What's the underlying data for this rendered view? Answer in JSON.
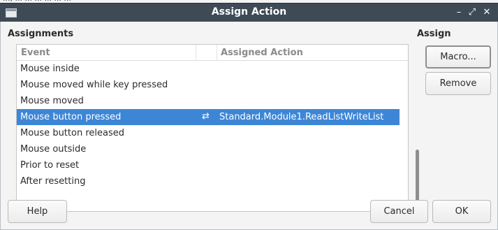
{
  "background_text": "..., ... ... ... ... ... ...",
  "window": {
    "title": "Assign Action",
    "min_label": "–",
    "max_label": "⤢",
    "close_label": "✕"
  },
  "assignments_label": "Assignments",
  "assign_label": "Assign",
  "columns": {
    "event": "Event",
    "assigned_action": "Assigned Action"
  },
  "rows": [
    {
      "event": "Mouse inside",
      "action": "",
      "swap": ""
    },
    {
      "event": "Mouse moved while key pressed",
      "action": "",
      "swap": ""
    },
    {
      "event": "Mouse moved",
      "action": "",
      "swap": ""
    },
    {
      "event": "Mouse button pressed",
      "action": "Standard.Module1.ReadListWriteList",
      "swap": "⇄",
      "selected": true
    },
    {
      "event": "Mouse button released",
      "action": "",
      "swap": ""
    },
    {
      "event": "Mouse outside",
      "action": "",
      "swap": ""
    },
    {
      "event": "Prior to reset",
      "action": "",
      "swap": ""
    },
    {
      "event": "After resetting",
      "action": "",
      "swap": ""
    }
  ],
  "buttons": {
    "macro": "Macro...",
    "remove": "Remove",
    "help": "Help",
    "cancel": "Cancel",
    "ok": "OK"
  },
  "icons": {
    "window_icon": "window-icon",
    "swap": "swap-arrows-icon"
  },
  "colors": {
    "titlebar": "#3f4a57",
    "selection": "#3d86d6"
  }
}
